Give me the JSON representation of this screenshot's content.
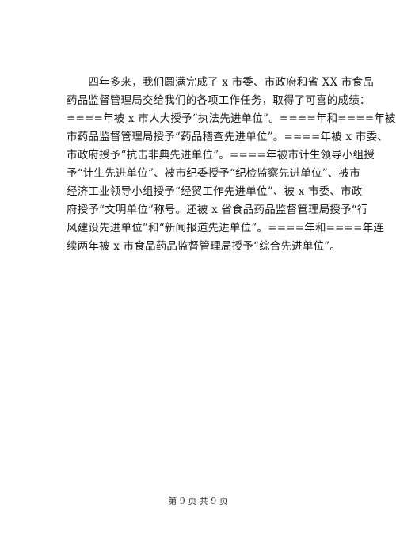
{
  "document": {
    "paragraph_lines": [
      "　　四年多来，我们圆满完成了 x 市委、市政府和省 XX 市食品",
      "药品监督管理局交给我们的各项工作任务，取得了可喜的成绩：",
      "====年被 x 市人大授予“执法先进单位”。====年和====年被 x",
      "市药品监督管理局授予“药品稽查先进单位”。====年被 x 市委、",
      "市政府授予“抗击非典先进单位”。====年被市计生领导小组授",
      "予“计生先进单位”、被市纪委授予“纪检监察先进单位”、被市",
      "经济工业领导小组授予“经贸工作先进单位”、被 x 市委、市政",
      "府授予“文明单位”称号。还被 x 省食品药品监督管理局授予“行",
      "风建设先进单位”和“新闻报道先进单位”。====年和====年连",
      "续两年被 x 市食品药品监督管理局授予“综合先进单位”。"
    ]
  },
  "footer": {
    "page_label": "第 9 页 共 9 页"
  }
}
